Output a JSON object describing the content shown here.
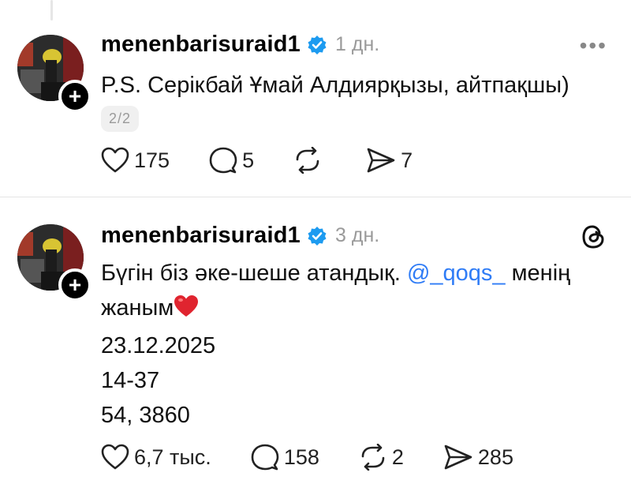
{
  "posts": [
    {
      "username": "menenbarisuraid1",
      "time": "1 дн.",
      "text": "P.S. Серікбай Ұмай Алдиярқызы, айтпақшы)",
      "thread_counter": "2/2",
      "likes": "175",
      "replies": "5",
      "reposts": "",
      "shares": "7"
    },
    {
      "username": "menenbarisuraid1",
      "time": "3 дн.",
      "text_before_mention": "Бүгін біз әке-шеше атандық. ",
      "mention": "@_qoqs_",
      "text_after_mention": " менің жаным",
      "emoji": "❤️",
      "lines": [
        "23.12.2025",
        "14-37",
        "54, 3860"
      ],
      "likes": "6,7 тыс.",
      "replies": "158",
      "reposts": "2",
      "shares": "285"
    }
  ],
  "colors": {
    "verified": "#1d9bf0",
    "mention": "#2f7cf6",
    "muted": "#9a9a9a"
  }
}
